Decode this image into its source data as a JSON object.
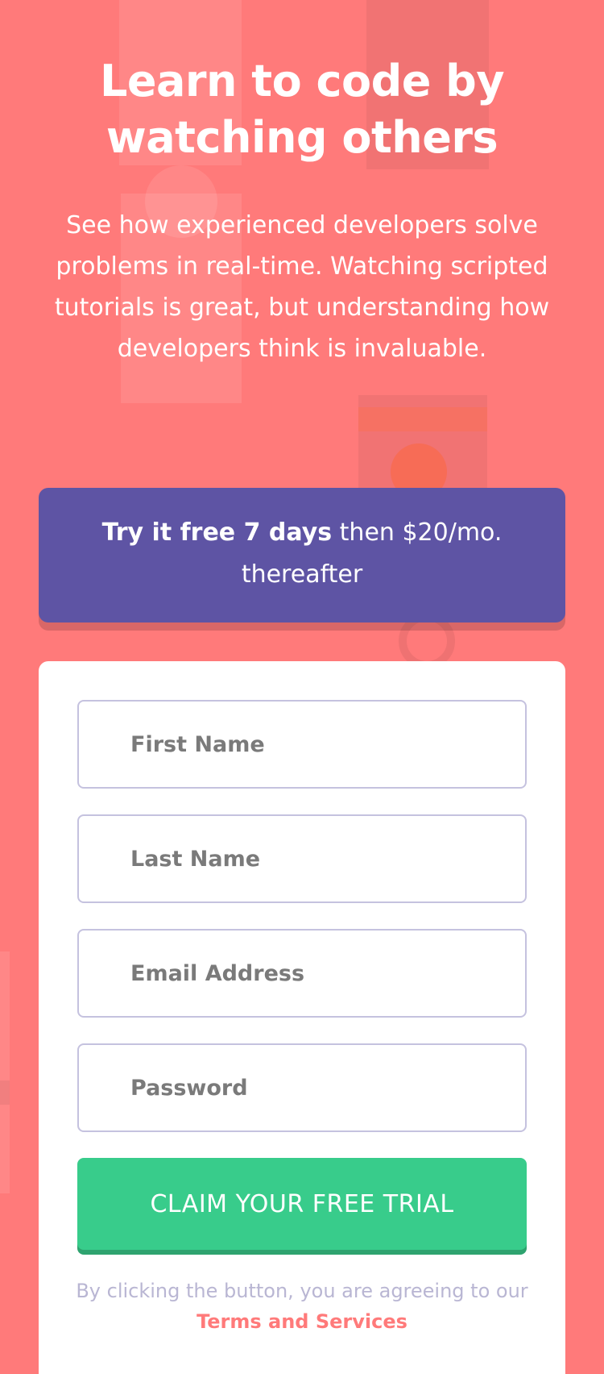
{
  "hero": {
    "title": "Learn to code by watching others",
    "text": "See how experienced developers solve problems in real-time. Watching scripted tutorials is great, but understanding how developers think is invaluable."
  },
  "offer": {
    "bold": "Try it free 7 days",
    "rest": " then $20/mo. thereafter"
  },
  "form": {
    "first_name_placeholder": "First Name",
    "last_name_placeholder": "Last Name",
    "email_placeholder": "Email Address",
    "password_placeholder": "Password",
    "cta_label": "CLAIM YOUR FREE TRIAL",
    "terms_prefix": "By clicking the button, you are agreeing to our",
    "terms_link": "Terms and Services"
  },
  "colors": {
    "background": "#ff7a7a",
    "offer_bg": "#5e54a4",
    "cta": "#38cc8b",
    "field_border": "#c5c2df",
    "terms_text": "#b9b6d3"
  }
}
